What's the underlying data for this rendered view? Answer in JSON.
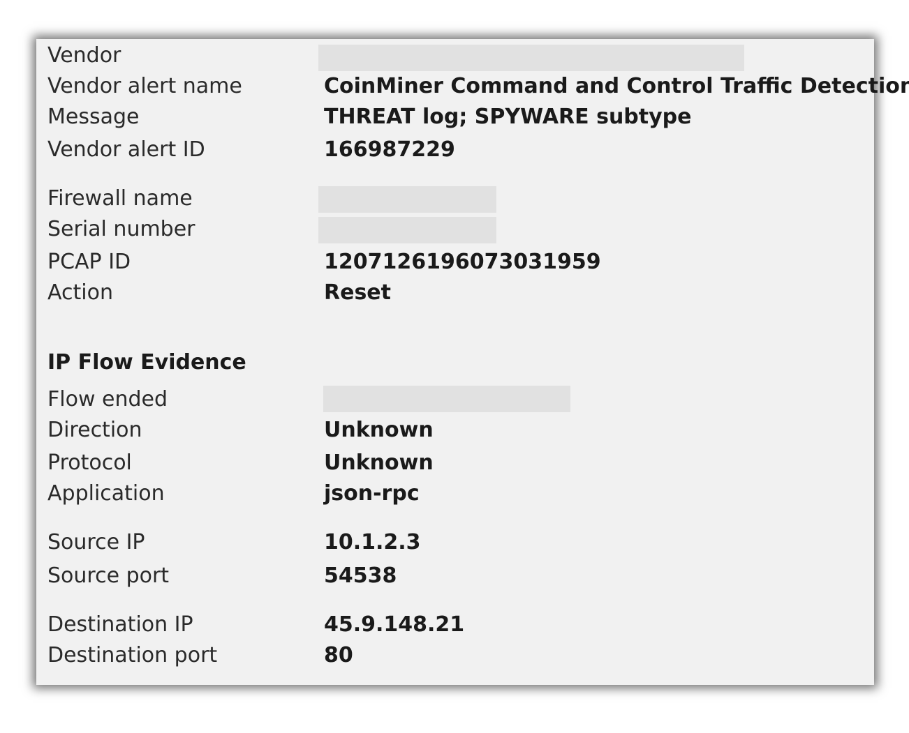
{
  "alert": {
    "vendor_label": "Vendor",
    "vendor_alert_name_label": "Vendor alert name",
    "vendor_alert_name_value": "CoinMiner Command and Control Traffic Detection",
    "message_label": "Message",
    "message_value": "THREAT log; SPYWARE subtype",
    "vendor_alert_id_label": "Vendor alert ID",
    "vendor_alert_id_value": "166987229"
  },
  "firewall": {
    "firewall_name_label": "Firewall name",
    "serial_number_label": "Serial number",
    "pcap_id_label": "PCAP ID",
    "pcap_id_value": "1207126196073031959",
    "action_label": "Action",
    "action_value": "Reset"
  },
  "ip_flow": {
    "section_title": "IP Flow Evidence",
    "flow_ended_label": "Flow ended",
    "direction_label": "Direction",
    "direction_value": "Unknown",
    "protocol_label": "Protocol",
    "protocol_value": "Unknown",
    "application_label": "Application",
    "application_value": "json-rpc",
    "source_ip_label": "Source IP",
    "source_ip_value": "10.1.2.3",
    "source_port_label": "Source port",
    "source_port_value": "54538",
    "destination_ip_label": "Destination IP",
    "destination_ip_value": "45.9.148.21",
    "destination_port_label": "Destination port",
    "destination_port_value": "80"
  }
}
